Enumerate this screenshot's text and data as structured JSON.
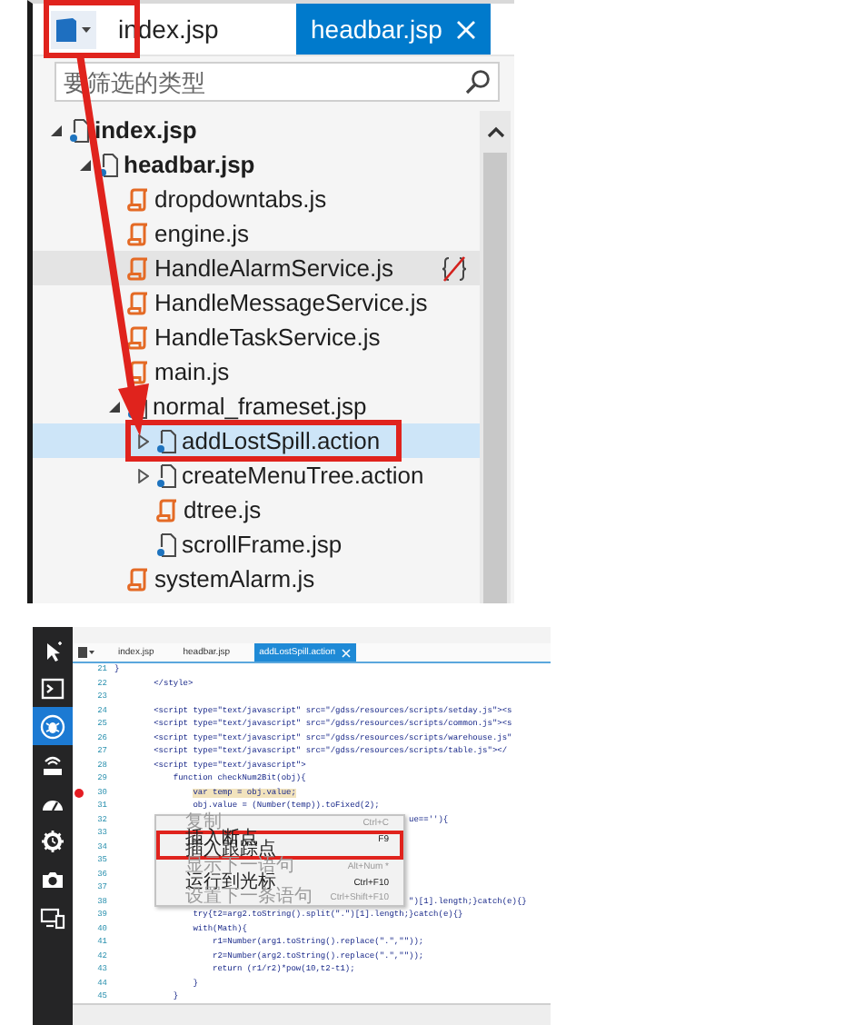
{
  "explorer": {
    "file_menu_button": {
      "annotated": true
    },
    "tabs": [
      {
        "label": "index.jsp",
        "selected": false
      },
      {
        "label": "headbar.jsp",
        "selected": true
      }
    ],
    "filter": {
      "placeholder": "要筛选的类型"
    },
    "tree": [
      {
        "label": "index.jsp",
        "kind": "jsp",
        "bold": true,
        "expanded": true,
        "selected": false,
        "hovered": false,
        "annotated": false,
        "children": [
          {
            "label": "headbar.jsp",
            "kind": "jsp",
            "bold": true,
            "expanded": true,
            "selected": false,
            "hovered": false,
            "annotated": false,
            "children": [
              {
                "label": "dropdowntabs.js",
                "kind": "js",
                "bold": false,
                "selected": false,
                "hovered": false,
                "annotated": false
              },
              {
                "label": "engine.js",
                "kind": "js",
                "bold": false,
                "selected": false,
                "hovered": false,
                "annotated": false
              },
              {
                "label": "HandleAlarmService.js",
                "kind": "js",
                "bold": false,
                "selected": false,
                "hovered": true,
                "annotated": false
              },
              {
                "label": "HandleMessageService.js",
                "kind": "js",
                "bold": false,
                "selected": false,
                "hovered": false,
                "annotated": false
              },
              {
                "label": "HandleTaskService.js",
                "kind": "js",
                "bold": false,
                "selected": false,
                "hovered": false,
                "annotated": false
              },
              {
                "label": "main.js",
                "kind": "js",
                "bold": false,
                "selected": false,
                "hovered": false,
                "annotated": false
              },
              {
                "label": "normal_frameset.jsp",
                "kind": "jsp",
                "bold": false,
                "expanded": true,
                "selected": false,
                "hovered": false,
                "annotated": false,
                "children": [
                  {
                    "label": "addLostSpill.action",
                    "kind": "jsp",
                    "bold": false,
                    "expanded": false,
                    "selected": true,
                    "hovered": false,
                    "annotated": true
                  },
                  {
                    "label": "createMenuTree.action",
                    "kind": "jsp",
                    "bold": false,
                    "expanded": false,
                    "selected": false,
                    "hovered": false,
                    "annotated": false
                  },
                  {
                    "label": "dtree.js",
                    "kind": "js",
                    "bold": false,
                    "selected": false,
                    "hovered": false,
                    "annotated": false
                  },
                  {
                    "label": "scrollFrame.jsp",
                    "kind": "jsp",
                    "bold": false,
                    "selected": false,
                    "hovered": false,
                    "annotated": false
                  }
                ]
              },
              {
                "label": "systemAlarm.js",
                "kind": "js",
                "bold": false,
                "selected": false,
                "hovered": false,
                "annotated": false
              }
            ]
          }
        ]
      }
    ]
  },
  "debugger": {
    "sidebar": [
      {
        "selected": false
      },
      {
        "selected": false
      },
      {
        "selected": true
      },
      {
        "selected": false
      },
      {
        "selected": false
      },
      {
        "selected": false
      },
      {
        "selected": false
      },
      {
        "selected": false
      }
    ],
    "tabs": [
      {
        "label": "index.jsp",
        "selected": false
      },
      {
        "label": "headbar.jsp",
        "selected": false
      },
      {
        "label": "addLostSpill.action",
        "selected": true
      }
    ],
    "code": [
      {
        "number": "21",
        "text": "}",
        "breakpoint": false
      },
      {
        "number": "22",
        "text": "        </style>",
        "breakpoint": false
      },
      {
        "number": "23",
        "breakpoint": false
      },
      {
        "number": "24",
        "text": "        <script type=\"text/javascript\" src=\"/gdss/resources/scripts/setday.js\"><s",
        "breakpoint": false
      },
      {
        "number": "25",
        "text": "        <script type=\"text/javascript\" src=\"/gdss/resources/scripts/common.js\"><s",
        "breakpoint": false
      },
      {
        "number": "26",
        "text": "        <script type=\"text/javascript\" src=\"/gdss/resources/scripts/warehouse.js\"",
        "breakpoint": false
      },
      {
        "number": "27",
        "text": "        <script type=\"text/javascript\" src=\"/gdss/resources/scripts/table.js\"></",
        "breakpoint": false
      },
      {
        "number": "28",
        "text": "        <script type=\"text/javascript\">",
        "breakpoint": false
      },
      {
        "number": "29",
        "text": "            function checkNum2Bit(obj){",
        "breakpoint": false
      },
      {
        "number": "30",
        "text": "                var temp = obj.value;",
        "breakpoint": true
      },
      {
        "number": "31",
        "text": "                obj.value = (Number(temp)).toFixed(2);",
        "breakpoint": false
      },
      {
        "number": "32",
        "text": "                                                            ue==''){",
        "breakpoint": false
      },
      {
        "number": "33",
        "breakpoint": false
      },
      {
        "number": "34",
        "breakpoint": false
      },
      {
        "number": "35",
        "breakpoint": false
      },
      {
        "number": "36",
        "breakpoint": false
      },
      {
        "number": "37",
        "breakpoint": false
      },
      {
        "number": "38",
        "text": "                                                            \")[1].length;}catch(e){}",
        "breakpoint": false
      },
      {
        "number": "39",
        "text": "                try{t2=arg2.toString().split(\".\")[1].length;}catch(e){}",
        "breakpoint": false
      },
      {
        "number": "40",
        "text": "                with(Math){",
        "breakpoint": false
      },
      {
        "number": "41",
        "text": "                    r1=Number(arg1.toString().replace(\".\",\"\"));",
        "breakpoint": false
      },
      {
        "number": "42",
        "text": "                    r2=Number(arg2.toString().replace(\".\",\"\"));",
        "breakpoint": false
      },
      {
        "number": "43",
        "text": "                    return (r1/r2)*pow(10,t2-t1);",
        "breakpoint": false
      },
      {
        "number": "44",
        "text": "                }",
        "breakpoint": false
      },
      {
        "number": "45",
        "text": "            }",
        "breakpoint": false
      }
    ],
    "context_menu": {
      "items": [
        {
          "label": "复制",
          "shortcut": "Ctrl+C",
          "disabled": true,
          "annotated": false
        },
        {
          "label": "插入断点",
          "shortcut": "F9",
          "disabled": false,
          "annotated": true
        },
        {
          "label": "插入跟踪点",
          "disabled": false,
          "annotated": true
        },
        {
          "label": "显示下一语句",
          "shortcut": "Alt+Num *",
          "disabled": true,
          "annotated": false
        },
        {
          "label": "运行到光标",
          "shortcut": "Ctrl+F10",
          "disabled": false,
          "annotated": false
        },
        {
          "label": "设置下一条语句",
          "shortcut": "Ctrl+Shift+F10",
          "disabled": true,
          "annotated": false
        }
      ]
    }
  }
}
